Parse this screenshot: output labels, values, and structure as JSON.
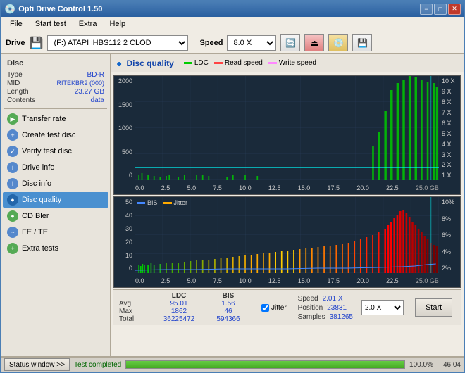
{
  "titleBar": {
    "title": "Opti Drive Control 1.50",
    "icon": "💿",
    "buttons": [
      "−",
      "□",
      "✕"
    ]
  },
  "menuBar": {
    "items": [
      "File",
      "Start test",
      "Extra",
      "Help"
    ]
  },
  "driveBar": {
    "label": "Drive",
    "driveValue": "(F:)  ATAPI iHBS112  2 CLOD",
    "speedLabel": "Speed",
    "speedValue": "8.0 X"
  },
  "sidebar": {
    "discSectionLabel": "Disc",
    "discInfo": [
      {
        "key": "Type",
        "value": "BD-R"
      },
      {
        "key": "MID",
        "value": "RITEKBR2 (000)"
      },
      {
        "key": "Length",
        "value": "23.27 GB"
      },
      {
        "key": "Contents",
        "value": "data"
      }
    ],
    "buttons": [
      {
        "id": "transfer-rate",
        "label": "Transfer rate",
        "active": false
      },
      {
        "id": "create-test-disc",
        "label": "Create test disc",
        "active": false
      },
      {
        "id": "verify-test-disc",
        "label": "Verify test disc",
        "active": false
      },
      {
        "id": "drive-info",
        "label": "Drive info",
        "active": false
      },
      {
        "id": "disc-info",
        "label": "Disc info",
        "active": false
      },
      {
        "id": "disc-quality",
        "label": "Disc quality",
        "active": true
      },
      {
        "id": "cd-bler",
        "label": "CD Bler",
        "active": false
      },
      {
        "id": "fe-te",
        "label": "FE / TE",
        "active": false
      },
      {
        "id": "extra-tests",
        "label": "Extra tests",
        "active": false
      }
    ],
    "statusWindowBtn": "Status window >>"
  },
  "discQuality": {
    "title": "Disc quality",
    "legend": [
      {
        "label": "LDC",
        "color": "#00cc00"
      },
      {
        "label": "Read speed",
        "color": "#ff4444"
      },
      {
        "label": "Write speed",
        "color": "#ff88ff"
      }
    ],
    "upperChart": {
      "yAxisLeft": [
        "2000",
        "1500",
        "1000",
        "500",
        "0"
      ],
      "yAxisRight": [
        "10 X",
        "9 X",
        "8 X",
        "7 X",
        "6 X",
        "5 X",
        "4 X",
        "3 X",
        "2 X",
        "1 X"
      ],
      "xAxis": [
        "0.0",
        "2.5",
        "5.0",
        "7.5",
        "10.0",
        "12.5",
        "15.0",
        "17.5",
        "20.0",
        "22.5",
        "25.0 GB"
      ]
    },
    "lowerChart": {
      "legendBIS": "BIS",
      "legendJitter": "Jitter",
      "yAxisLeft": [
        "50",
        "40",
        "30",
        "20",
        "10",
        "0"
      ],
      "yAxisRight": [
        "10%",
        "8%",
        "6%",
        "4%",
        "2%"
      ],
      "xAxis": [
        "0.0",
        "2.5",
        "5.0",
        "7.5",
        "10.0",
        "12.5",
        "15.0",
        "17.5",
        "20.0",
        "22.5",
        "25.0 GB"
      ]
    }
  },
  "stats": {
    "headers": {
      "ldc": "LDC",
      "bis": "BIS"
    },
    "rows": [
      {
        "label": "Avg",
        "ldc": "95.01",
        "bis": "1.56"
      },
      {
        "label": "Max",
        "ldc": "1862",
        "bis": "46"
      },
      {
        "label": "Total",
        "ldc": "36225472",
        "bis": "594366"
      }
    ],
    "jitterChecked": true,
    "jitterLabel": "Jitter",
    "speedLabel": "Speed",
    "speedValue": "2.01 X",
    "speedSelect": "2.0 X",
    "positionLabel": "Position",
    "positionValue": "23831",
    "samplesLabel": "Samples",
    "samplesValue": "381265",
    "startBtn": "Start"
  },
  "statusBar": {
    "statusWindowBtn": "Status window >>",
    "statusText": "Test completed",
    "progress": 100,
    "progressText": "100.0%",
    "time": "46:04"
  }
}
